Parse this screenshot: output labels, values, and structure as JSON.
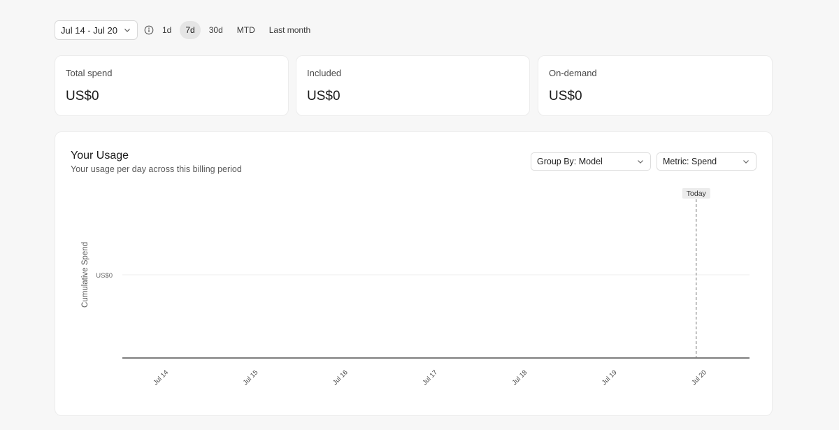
{
  "filters": {
    "date_range": "Jul 14 - Jul 20",
    "ranges": [
      "1d",
      "7d",
      "30d",
      "MTD",
      "Last month"
    ],
    "active_range": "7d"
  },
  "cards": [
    {
      "label": "Total spend",
      "value": "US$0"
    },
    {
      "label": "Included",
      "value": "US$0"
    },
    {
      "label": "On-demand",
      "value": "US$0"
    }
  ],
  "usage": {
    "title": "Your Usage",
    "subtitle": "Your usage per day across this billing period",
    "group_by": "Group By: Model",
    "metric": "Metric: Spend"
  },
  "chart_data": {
    "type": "line",
    "x": [
      "Jul 14",
      "Jul 15",
      "Jul 16",
      "Jul 17",
      "Jul 18",
      "Jul 19",
      "Jul 20"
    ],
    "series": [],
    "ylabel": "Cumulative Spend",
    "y_ticks": [
      "US$0"
    ],
    "today_marker": {
      "x": "Jul 20",
      "label": "Today"
    },
    "grid": true
  },
  "colors": {
    "active_pill": "#e5e5e5",
    "axis": "#333333",
    "today_line": "#777777"
  }
}
